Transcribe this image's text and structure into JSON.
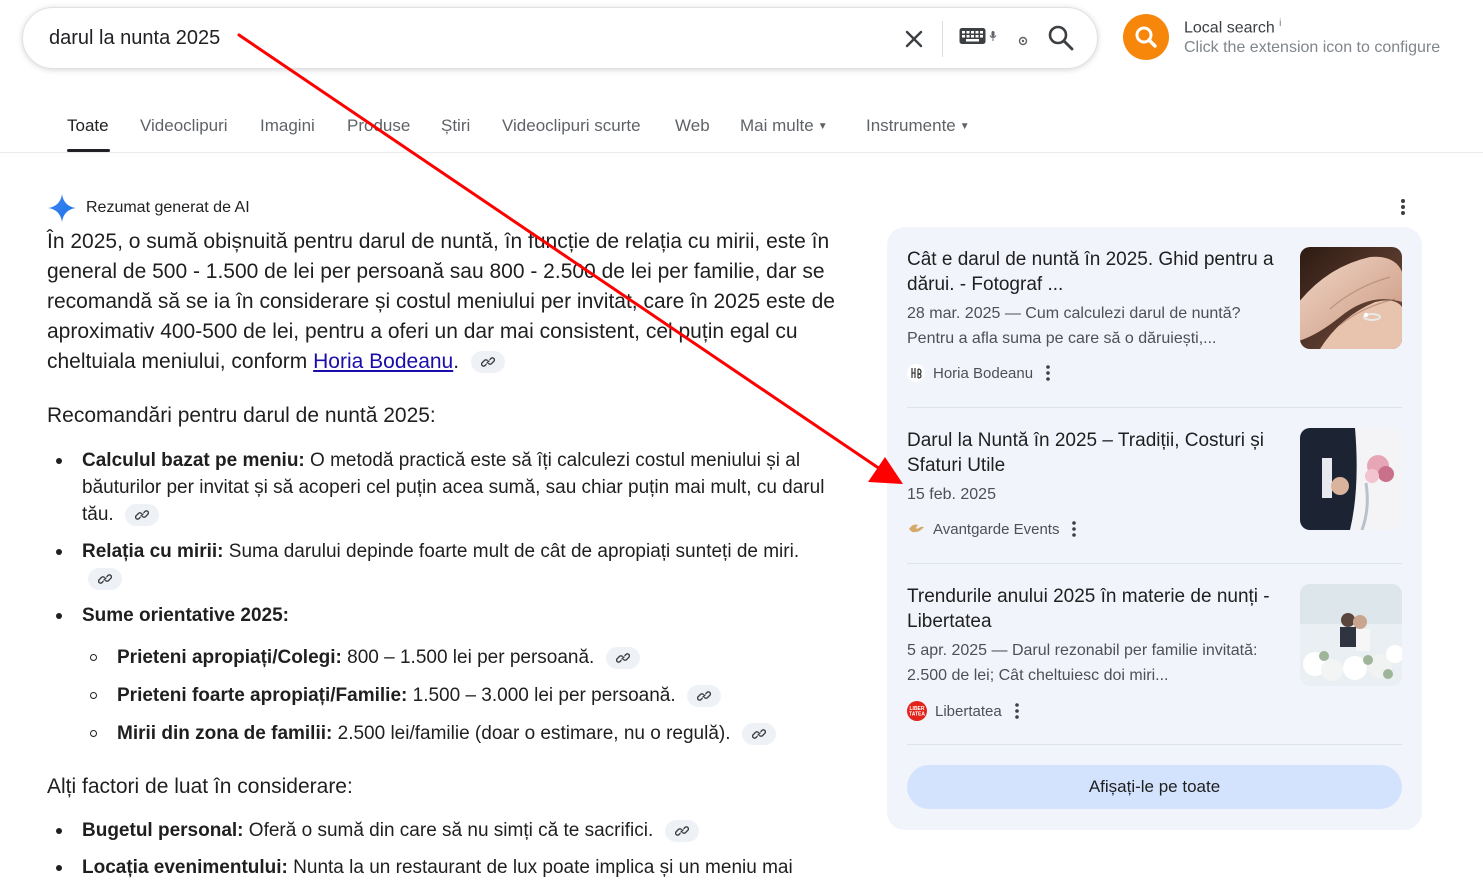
{
  "search": {
    "query": "darul la nunta 2025"
  },
  "extension": {
    "title": "Local search",
    "info_mark": "i",
    "subtitle": "Click the extension icon to configure"
  },
  "tabs": [
    {
      "label": "Toate"
    },
    {
      "label": "Videoclipuri"
    },
    {
      "label": "Imagini"
    },
    {
      "label": "Produse"
    },
    {
      "label": "Știri"
    },
    {
      "label": "Videoclipuri scurte"
    },
    {
      "label": "Web"
    },
    {
      "label": "Mai multe"
    },
    {
      "label": "Instrumente"
    }
  ],
  "ai": {
    "label": "Rezumat generat de AI",
    "overview_text": "În 2025, o sumă obișnuită pentru darul de nuntă, în funcție de relația cu mirii, este în general de 500 - 1.500 de lei per persoană sau 800 - 2.500 de lei per familie, dar se recomandă să se ia în considerare și costul meniului per invitat, care în 2025 este de aproximativ 400-500 de lei, pentru a oferi un dar mai consistent, cel puțin egal cu cheltuiala meniului, conform ",
    "overview_link": "Horia Bodeanu",
    "overview_end": ".",
    "section1": "Recomandări pentru darul de nuntă 2025:",
    "items": [
      {
        "bold": "Calculul bazat pe meniu:",
        "text": " O metodă practică este să îți calculezi costul meniului și al băuturilor per invitat și să acoperi cel puțin acea sumă, sau chiar puțin mai mult, cu darul tău."
      },
      {
        "bold": "Relația cu mirii:",
        "text": " Suma darului depinde foarte mult de cât de apropiați sunteți de miri."
      },
      {
        "bold": "Sume orientative 2025:",
        "text": ""
      }
    ],
    "subitems": [
      {
        "bold": "Prieteni apropiați/Colegi:",
        "text": " 800 – 1.500 lei per persoană."
      },
      {
        "bold": "Prieteni foarte apropiați/Familie:",
        "text": " 1.500 – 3.000 lei per persoană."
      },
      {
        "bold": "Mirii din zona de familii:",
        "text": " 2.500 lei/familie (doar o estimare, nu o regulă)."
      }
    ],
    "section2": "Alți factori de luat în considerare:",
    "items2": [
      {
        "bold": "Bugetul personal:",
        "text": " Oferă o sumă din care să nu simți că te sacrifici."
      },
      {
        "bold": "Locația evenimentului:",
        "text": " Nunta la un restaurant de lux poate implica și un meniu mai"
      }
    ]
  },
  "sources": [
    {
      "title": "Cât e darul de nuntă în 2025. Ghid pentru a dărui. - Fotograf ...",
      "snippet": "28 mar. 2025 — Cum calculezi darul de nuntă? Pentru a afla suma pe care să o dăruiești,...",
      "site": "Horia Bodeanu"
    },
    {
      "title": "Darul la Nuntă în 2025 – Tradiții, Costuri și Sfaturi Utile",
      "snippet": "15 feb. 2025",
      "site": "Avantgarde Events"
    },
    {
      "title": "Trendurile anului 2025 în materie de nunți - Libertatea",
      "snippet": "5 apr. 2025 — Darul rezonabil per familie invitată: 2.500 de lei; Cât cheltuiesc doi miri...",
      "site": "Libertatea"
    }
  ],
  "show_all_label": "Afișați-le pe toate",
  "colors": {
    "link": "#1a0dab",
    "panel_bg": "#f1f5fb",
    "show_all_bg": "#d3e3fd",
    "extension_orange": "#f7870a",
    "annotation_arrow": "#ff0000"
  }
}
